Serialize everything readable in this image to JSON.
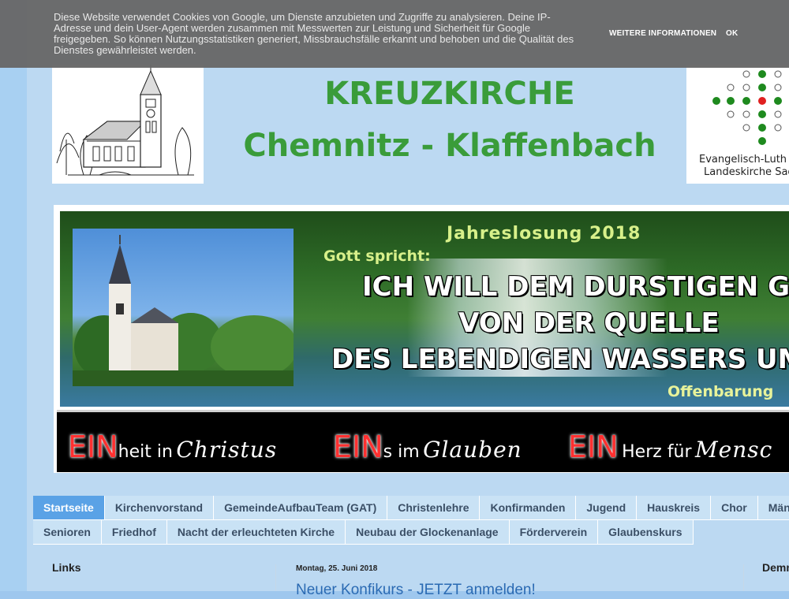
{
  "cookie_bar": {
    "text": "Diese Website verwendet Cookies von Google, um Dienste anzubieten und Zugriffe zu analysieren. Deine IP-Adresse und dein User-Agent werden zusammen mit Messwerten zur Leistung und Sicherheit für Google freigegeben. So können Nutzungsstatistiken generiert, Missbrauchsfälle erkannt und behoben und die Qualität des Dienstes gewährleistet werden.",
    "more_info": "WEITERE INFORMATIONEN",
    "ok": "OK"
  },
  "header": {
    "title": "KREUZKIRCHE",
    "subtitle": "Chemnitz - Klaffenbach",
    "logo_line1": "Evangelisch-Luth",
    "logo_line2": "Landeskirche Sac"
  },
  "banner": {
    "jahreslosung": "Jahreslosung 2018",
    "gott_spricht": "Gott spricht:",
    "line1": "ICH WILL DEM DURSTIGEN GEBEN",
    "line2": "VON DER QUELLE",
    "line3": "DES LEBENDIGEN WASSERS UMSON",
    "reference": "Offenbarung",
    "ein1_big": "EIN",
    "ein1_small": "heit in",
    "ein1_script": "Christus",
    "ein2_big": "EIN",
    "ein2_small": "s im",
    "ein2_script": "Glauben",
    "ein3_big": "EIN",
    "ein3_small": "Herz für",
    "ein3_script": "Mensc"
  },
  "nav": {
    "row1": [
      "Startseite",
      "Kirchenvorstand",
      "GemeindeAufbauTeam (GAT)",
      "Christenlehre",
      "Konfirmanden",
      "Jugend",
      "Hauskreis",
      "Chor",
      "Männer"
    ],
    "row2": [
      "Senioren",
      "Friedhof",
      "Nacht der erleuchteten Kirche",
      "Neubau der Glockenanlage",
      "Förderverein",
      "Glaubenskurs"
    ]
  },
  "sidebar": {
    "links_title": "Links"
  },
  "post": {
    "date": "Montag, 25. Juni 2018",
    "title": "Neuer Konfikurs - JETZT anmelden!"
  },
  "right_sidebar": {
    "title": "Demn"
  },
  "colors": {
    "title_green": "#3a9c3a",
    "active_tab": "#5aa2e6",
    "logo_green": "#1e8a1e",
    "logo_red": "#e02020"
  }
}
